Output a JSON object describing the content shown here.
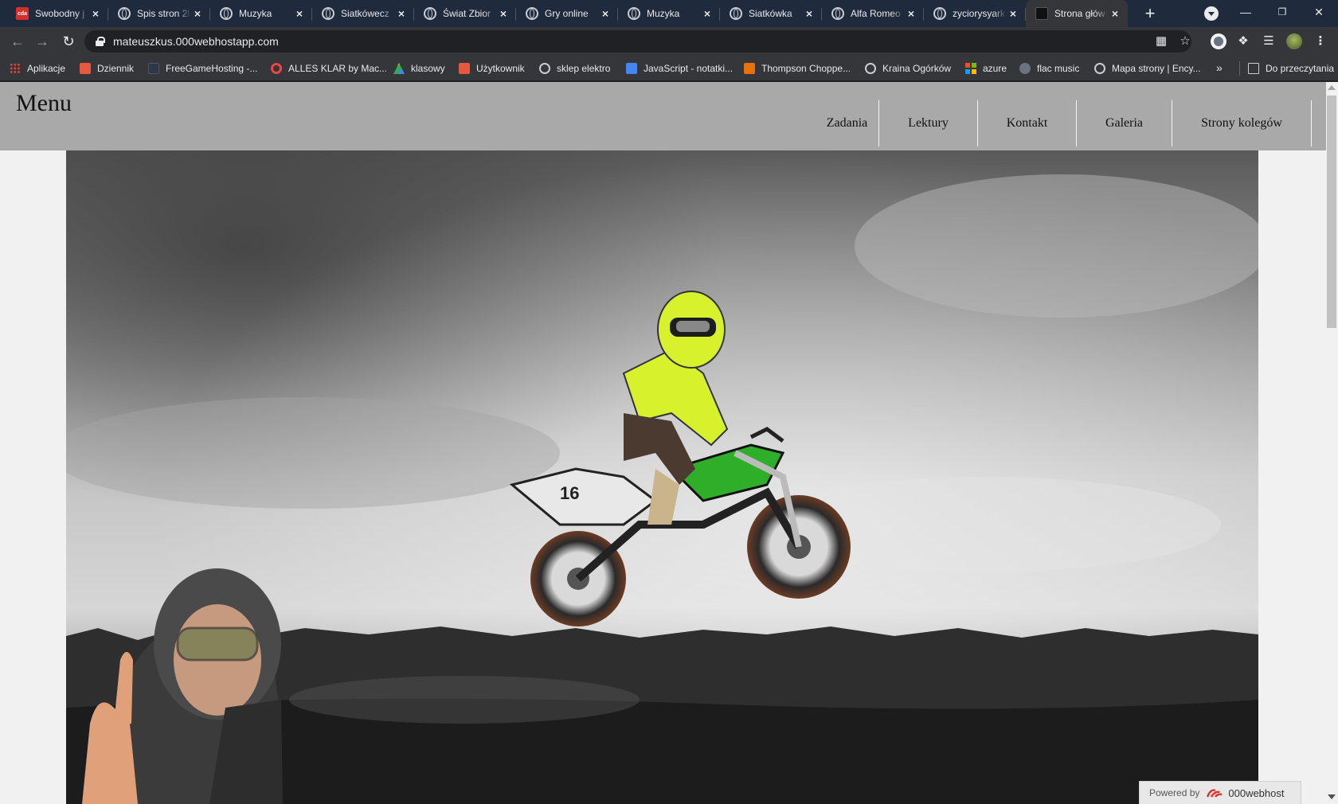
{
  "browser": {
    "tabs": [
      {
        "title": "Swobodny j",
        "favicon": "cda-icon",
        "active": false
      },
      {
        "title": "Spis stron 2l",
        "favicon": "globe-icon",
        "active": false
      },
      {
        "title": "Muzyka",
        "favicon": "globe-icon",
        "active": false
      },
      {
        "title": "Siatkówecz",
        "favicon": "globe-icon",
        "active": false
      },
      {
        "title": "Świat Zbior",
        "favicon": "globe-icon",
        "active": false
      },
      {
        "title": "Gry online",
        "favicon": "globe-icon",
        "active": false
      },
      {
        "title": "Muzyka",
        "favicon": "globe-icon",
        "active": false
      },
      {
        "title": "Siatkówka",
        "favicon": "globe-icon",
        "active": false
      },
      {
        "title": "Alfa Romeo",
        "favicon": "globe-icon",
        "active": false
      },
      {
        "title": "zyciorysyark",
        "favicon": "globe-icon",
        "active": false
      },
      {
        "title": "Strona głów",
        "favicon": "page-icon",
        "active": true
      }
    ],
    "cda_favicon_text": "cda",
    "new_tab": "+",
    "url": "mateuszkus.000webhostapp.com",
    "window_controls": {
      "minimize": "—",
      "restore": "❐",
      "close": "✕"
    },
    "bookmarks": [
      {
        "label": "Aplikacje",
        "icon": "apps-icon"
      },
      {
        "label": "Dziennik",
        "icon": "dziennik-icon"
      },
      {
        "label": "FreeGameHosting -...",
        "icon": "freegamehosting-icon"
      },
      {
        "label": "ALLES KLAR by Mac...",
        "icon": "target-icon"
      },
      {
        "label": "klasowy",
        "icon": "drive-icon"
      },
      {
        "label": "Użytkownik",
        "icon": "user-site-icon"
      },
      {
        "label": "sklep elektro",
        "icon": "globe-icon"
      },
      {
        "label": "JavaScript - notatki...",
        "icon": "docs-icon"
      },
      {
        "label": "Thompson Choppe...",
        "icon": "thompson-icon"
      },
      {
        "label": "Kraina Ogórków",
        "icon": "globe-icon"
      },
      {
        "label": "azure",
        "icon": "microsoft-icon"
      },
      {
        "label": "flac music",
        "icon": "flac-icon"
      },
      {
        "label": "Mapa strony | Ency...",
        "icon": "globe-icon"
      }
    ],
    "bookmarks_overflow": "»",
    "reading_list": "Do przeczytania"
  },
  "site": {
    "title": "Menu",
    "nav": [
      "Zadania",
      "Lektury",
      "Kontakt",
      "Galeria",
      "Strony kolegów"
    ],
    "hero_description": "",
    "footer_badge": {
      "prefix": "Powered by",
      "brand": "000webhost"
    }
  },
  "colors": {
    "header_bg": "#a9a9a9",
    "page_bg": "#f1f1f1",
    "tabstrip_bg": "#1f2a3d",
    "toolbar_bg": "#35363a",
    "rider_jersey": "#d7f12d",
    "bike_green": "#2fae2a"
  }
}
